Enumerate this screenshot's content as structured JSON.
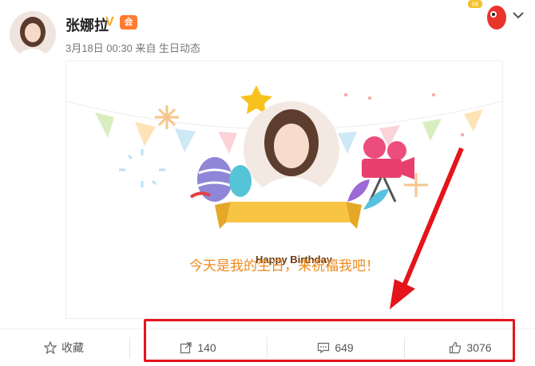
{
  "post": {
    "username": "张娜拉",
    "verified_mark": "V",
    "member_badge": "会",
    "meta": "3月18日 00:30 来自 生日动态"
  },
  "card": {
    "banner_text": "Happy Birthday",
    "wish_text": "今天是我的生日，来祝福我吧！"
  },
  "footer": {
    "favorite_label": "收藏",
    "repost_count": "140",
    "comment_count": "649",
    "like_count": "3076"
  },
  "mascot": {
    "badge": "Hi"
  },
  "colors": {
    "highlight": "#e5141b",
    "wish_text": "#ef8a1d",
    "verified": "#f6a623"
  }
}
